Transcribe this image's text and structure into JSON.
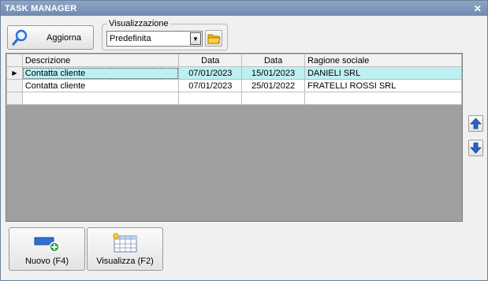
{
  "window": {
    "title": "TASK MANAGER",
    "close_glyph": "✕"
  },
  "toolbar": {
    "refresh_label": "Aggiorna",
    "refresh_icon": "search-icon"
  },
  "view": {
    "legend": "Visualizzazione",
    "selected": "Predefinita",
    "open_icon": "folder-icon"
  },
  "grid": {
    "columns": [
      "Descrizione",
      "Data",
      "Data",
      "Ragione sociale"
    ],
    "rows": [
      {
        "descrizione": "Contatta cliente",
        "data1": "07/01/2023",
        "data2": "15/01/2023",
        "ragione": "DANIELI SRL",
        "selected": true
      },
      {
        "descrizione": "Contatta cliente",
        "data1": "07/01/2023",
        "data2": "25/01/2022",
        "ragione": "FRATELLI ROSSI SRL",
        "selected": false
      }
    ],
    "selection_color": "#bdf0f3"
  },
  "nav": {
    "up_icon": "arrow-up-icon",
    "down_icon": "arrow-down-icon"
  },
  "actions": {
    "new_label": "Nuovo (F4)",
    "view_label": "Visualizza (F2)"
  },
  "colors": {
    "titlebar": "#7a93b8",
    "accent_arrow": "#2a63c7",
    "add_badge": "#2fa84f"
  }
}
